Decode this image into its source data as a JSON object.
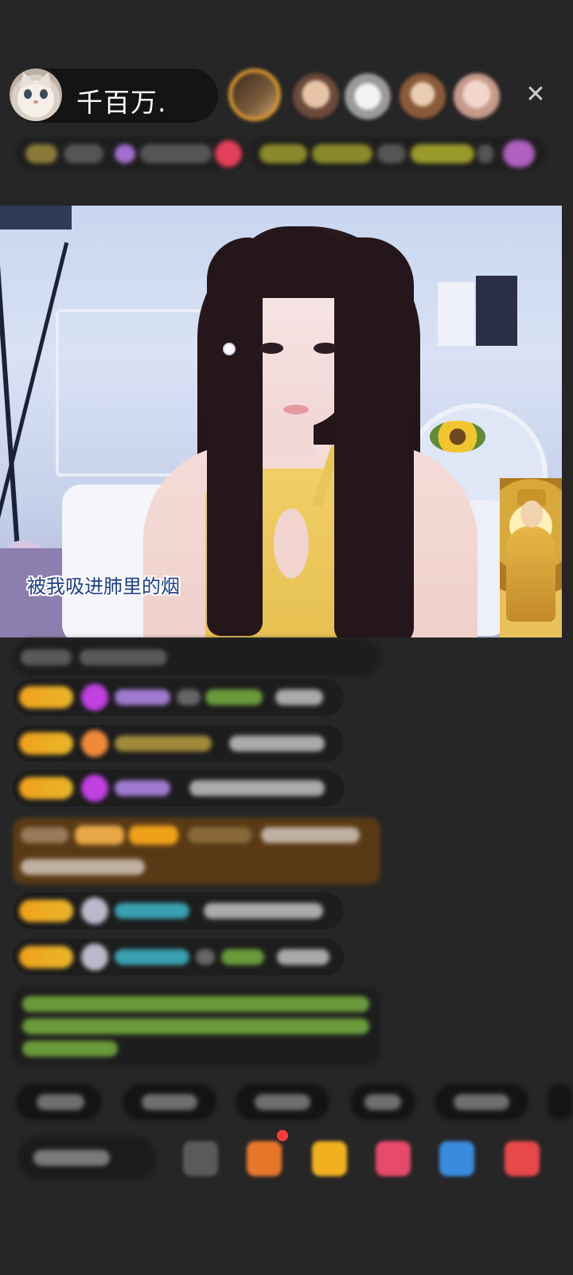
{
  "header": {
    "host_name": "千百万.",
    "viewers": [
      "viewer-1",
      "viewer-2",
      "viewer-3",
      "viewer-4",
      "viewer-5"
    ],
    "close_icon": "close-icon",
    "accent_color": "#d4942c"
  },
  "video": {
    "subtitle": "被我吸进肺里的烟"
  },
  "colors": {
    "background": "#262626",
    "chat_bubble": "#1d1d1d",
    "level_badge": "#f0a11a",
    "system_message": "#5a3a16",
    "green_text": "#7fb04a"
  }
}
